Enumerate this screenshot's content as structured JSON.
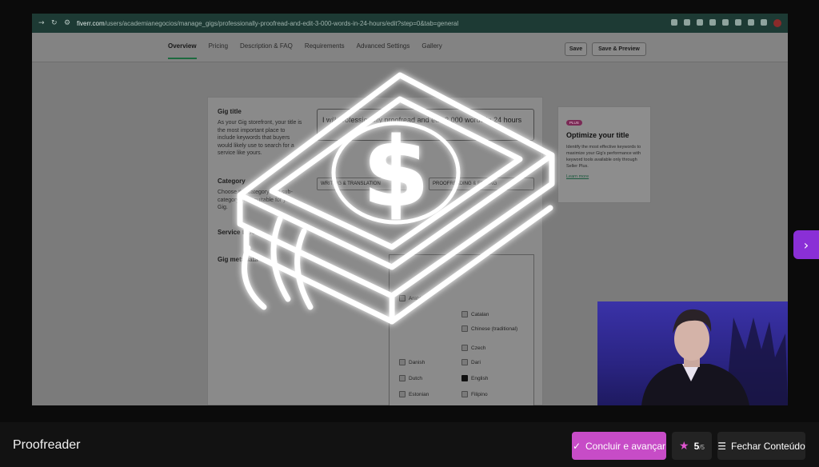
{
  "browser": {
    "url_host": "fiverr.com",
    "url_path": "/users/academianegocios/manage_gigs/professionally-proofread-and-edit-3-000-words-in-24-hours/edit?step=0&tab=general"
  },
  "gig_editor": {
    "tabs": [
      "Overview",
      "Pricing",
      "Description & FAQ",
      "Requirements",
      "Advanced Settings",
      "Gallery"
    ],
    "save_label": "Save",
    "save_preview_label": "Save & Preview",
    "gig_title_label": "Gig title",
    "gig_title_desc": "As your Gig storefront, your title is the most important place to include keywords that buyers would likely use to search for a service like yours.",
    "title_value": "I will professionally proofread and edit 3,000 words in 24 hours",
    "category_label": "Category",
    "category_desc": "Choose the category and sub-category most suitable for your Gig.",
    "category_value": "WRITING & TRANSLATION",
    "subcategory_value": "PROOFREADING & EDITING",
    "service_type_label": "Service type",
    "gig_metadata_label": "Gig metadata",
    "languages": [
      {
        "name": "Arabic",
        "checked": false
      },
      {
        "name": "Catalan",
        "checked": false
      },
      {
        "name": "Chinese (traditional)",
        "checked": false
      },
      {
        "name": "Czech",
        "checked": false
      },
      {
        "name": "Danish",
        "checked": false
      },
      {
        "name": "Dari",
        "checked": false
      },
      {
        "name": "Dutch",
        "checked": false
      },
      {
        "name": "English",
        "checked": true
      },
      {
        "name": "Estonian",
        "checked": false
      },
      {
        "name": "Filipino",
        "checked": false
      }
    ]
  },
  "tip": {
    "badge": "PLUS",
    "title": "Optimize your title",
    "body": "Identify the most effective keywords to maximize your Gig's performance with keyword tools available only through Seller Plus.",
    "link": "Learn more"
  },
  "player": {
    "lesson_title": "Proofreader",
    "complete_label": "Concluir e avançar",
    "rating_value": "5",
    "rating_total": "/5",
    "close_label": "Fechar Conteúdo",
    "next_icon": "chevron-right-icon",
    "accent_color": "#c74cc7"
  }
}
